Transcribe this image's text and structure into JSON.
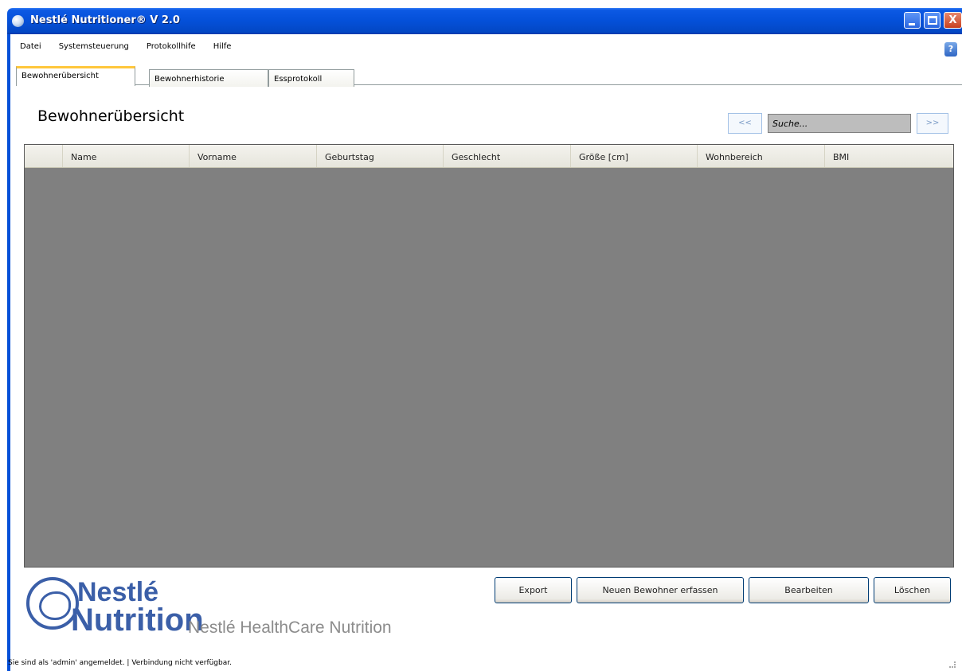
{
  "window": {
    "title": "Nestlé Nutritioner® V 2.0",
    "controls": {
      "minimize": "_",
      "maximize": "□",
      "close": "X"
    }
  },
  "menu": {
    "items": [
      "Datei",
      "Systemsteuerung",
      "Protokollhife",
      "Hilfe"
    ]
  },
  "help_button": "?",
  "tabs": [
    "Bewohnerübersicht",
    "Bewohnerhistorie",
    "Essprotokoll"
  ],
  "page": {
    "heading": "Bewohnerübersicht"
  },
  "search": {
    "prev_label": "<<",
    "next_label": ">>",
    "value": "Suche..."
  },
  "table": {
    "columns": [
      "Name",
      "Vorname",
      "Geburtstag",
      "Geschlecht",
      "Größe [cm]",
      "Wohnbereich",
      "BMI"
    ],
    "rows": []
  },
  "logo": {
    "brand_top": "Nestlé",
    "brand_bottom": "Nutrition",
    "tagline": "Nestlé HealthCare Nutrition"
  },
  "actions": {
    "export": "Export",
    "new_resident": "Neuen Bewohner erfassen",
    "edit": "Bearbeiten",
    "delete": "Löschen"
  },
  "status": {
    "text": "Sie sind als 'admin' angemeldet.  |  Verbindung nicht verfügbar."
  },
  "colors": {
    "titlebar": "#0450d8",
    "grid_background": "#808080",
    "brand_blue": "#3b5fa8",
    "active_tab_accent": "#ffc73c"
  }
}
